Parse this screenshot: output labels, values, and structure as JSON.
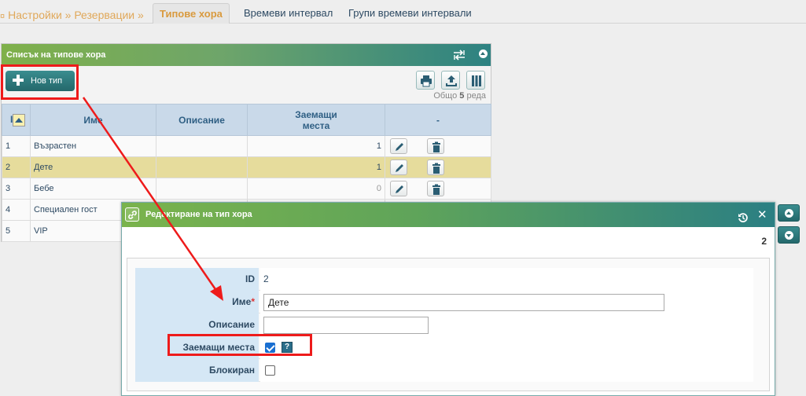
{
  "nav": {
    "breadcrumb": "Настройки » Резервации »",
    "tabs": [
      {
        "label": "Типове хора",
        "active": true
      },
      {
        "label": "Времеви интервал",
        "active": false
      },
      {
        "label": "Групи времеви интервали",
        "active": false
      }
    ]
  },
  "list_panel": {
    "title": "Списък на типове хора",
    "new_button": "Нов тип",
    "total_prefix": "Общо",
    "total_count": "5",
    "total_suffix": "реда",
    "columns": {
      "id": "I",
      "name": "Име",
      "description": "Описание",
      "seats": "Заемащи места",
      "actions": "-"
    },
    "rows": [
      {
        "id": "1",
        "name": "Възрастен",
        "description": "",
        "seats": "1"
      },
      {
        "id": "2",
        "name": "Дете",
        "description": "",
        "seats": "1"
      },
      {
        "id": "3",
        "name": "Бебе",
        "description": "",
        "seats": "0"
      },
      {
        "id": "4",
        "name": "Специален гост",
        "description": "",
        "seats": ""
      },
      {
        "id": "5",
        "name": "VIP",
        "description": "",
        "seats": ""
      }
    ],
    "selected_row": "2"
  },
  "edit_dialog": {
    "title": "Редактиране на тип хора",
    "record_id": "2",
    "fields": {
      "id_label": "ID",
      "id_value": "2",
      "name_label": "Име",
      "name_required": "*",
      "name_value": "Дете",
      "description_label": "Описание",
      "description_value": "",
      "seats_label": "Заемащи места",
      "seats_checked": true,
      "seats_help": "?",
      "blocked_label": "Блокиран",
      "blocked_checked": false
    }
  },
  "colors": {
    "accent": "#2d8282",
    "header_green": "#7fb04a",
    "annotation": "#ee1b1b",
    "selected_row": "#e6dc9c"
  }
}
